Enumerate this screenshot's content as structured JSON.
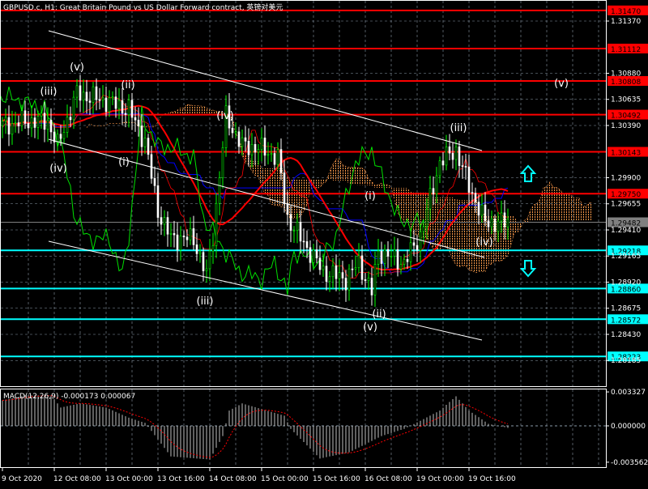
{
  "title": "GBPUSD.c, H1:  Great Britain Pound vs US Dollar Forward contract, 英镑对美元",
  "colors": {
    "background": "#000000",
    "grid": "#8a9aa8",
    "resistance": "#ff0000",
    "support": "#00ffff",
    "bull": "#00ff00",
    "bear": "#ffffff",
    "cloud": "#ff9a4a",
    "ma_red": "#ff0000",
    "ma_blue": "#0000ff",
    "chikou": "#00e000",
    "channel": "#ffffff",
    "macd_hist": "#c0c0c0",
    "macd_signal": "#ff0000"
  },
  "chart_data": {
    "type": "candlestick",
    "symbol": "GBPUSD.c",
    "timeframe": "H1",
    "ylim": [
      1.28185,
      1.3152
    ],
    "y_ticks": [
      "1.31370",
      "1.30880",
      "1.30635",
      "1.30390",
      "1.29900",
      "1.29655",
      "1.29410",
      "1.29165",
      "1.28920",
      "1.28675",
      "1.28430",
      "1.28185"
    ],
    "x_ticks": [
      "9 Oct 2020",
      "12 Oct 08:00",
      "13 Oct 00:00",
      "13 Oct 16:00",
      "14 Oct 08:00",
      "15 Oct 00:00",
      "15 Oct 16:00",
      "16 Oct 08:00",
      "19 Oct 00:00",
      "19 Oct 16:00"
    ],
    "x_tick_hours": [
      0,
      16,
      32,
      48,
      64,
      80,
      96,
      112,
      128,
      144
    ],
    "price_path_hours_price": [
      [
        0,
        1.3039
      ],
      [
        7,
        1.3043
      ],
      [
        14,
        1.3043
      ],
      [
        17,
        1.302
      ],
      [
        23,
        1.3069
      ],
      [
        32,
        1.3062
      ],
      [
        39,
        1.3054
      ],
      [
        44,
        1.3024
      ],
      [
        48,
        1.2959
      ],
      [
        52,
        1.2933
      ],
      [
        59,
        1.2933
      ],
      [
        63,
        1.2898
      ],
      [
        65,
        1.2936
      ],
      [
        69,
        1.3047
      ],
      [
        74,
        1.302
      ],
      [
        79,
        1.3018
      ],
      [
        85,
        1.3009
      ],
      [
        88,
        1.2952
      ],
      [
        93,
        1.2929
      ],
      [
        99,
        1.2902
      ],
      [
        106,
        1.2895
      ],
      [
        110,
        1.291
      ],
      [
        114,
        1.2883
      ],
      [
        116,
        1.2921
      ],
      [
        124,
        1.291
      ],
      [
        129,
        1.2936
      ],
      [
        135,
        1.3005
      ],
      [
        140,
        1.3016
      ],
      [
        144,
        1.2982
      ],
      [
        149,
        1.2948
      ],
      [
        156,
        1.29482
      ]
    ],
    "resistance_levels": [
      "1.31470",
      "1.31112",
      "1.30808",
      "1.30492",
      "1.30143",
      "1.29750"
    ],
    "support_levels": [
      "1.29218",
      "1.28860",
      "1.28572",
      "1.28223"
    ],
    "current_price": "1.29482",
    "wave_labels": [
      "(v)",
      "(iii)",
      "(ii)",
      "(iv)",
      "(i)",
      "(iv)",
      "(iii)",
      "(i)",
      "(ii)",
      "(v)",
      "(iii)",
      "(iv)",
      "(v)"
    ],
    "macd": {
      "label": "MACD(12,26,9) -0.000173 0.000067",
      "ylim": [
        -0.003562,
        0.003327
      ],
      "y_ticks": [
        "0.003327",
        "0.000000",
        "-0.003562"
      ],
      "hist_path_hours_value": [
        [
          0,
          0.0025
        ],
        [
          7,
          0.003
        ],
        [
          15,
          0.003
        ],
        [
          18,
          0.0018
        ],
        [
          24,
          0.0022
        ],
        [
          32,
          0.0018
        ],
        [
          39,
          0.0008
        ],
        [
          44,
          0.0003
        ],
        [
          46,
          -0.0005
        ],
        [
          52,
          -0.003
        ],
        [
          64,
          -0.0033
        ],
        [
          68,
          -0.001
        ],
        [
          70,
          0.0015
        ],
        [
          74,
          0.0022
        ],
        [
          87,
          0.001
        ],
        [
          89,
          -0.0003
        ],
        [
          98,
          -0.0032
        ],
        [
          107,
          -0.0026
        ],
        [
          117,
          -0.001
        ],
        [
          124,
          -0.0003
        ],
        [
          129,
          0.0005
        ],
        [
          135,
          0.0015
        ],
        [
          140,
          0.0029
        ],
        [
          144,
          0.0015
        ],
        [
          150,
          0.0002
        ],
        [
          156,
          -0.0002
        ]
      ]
    }
  }
}
